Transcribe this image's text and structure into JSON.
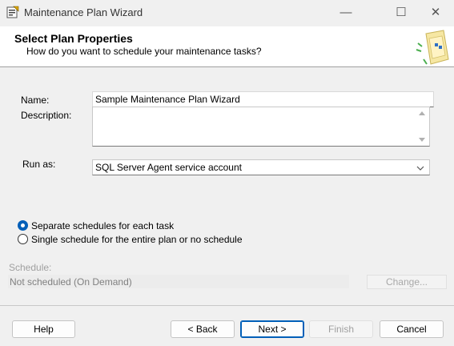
{
  "window": {
    "title": "Maintenance Plan Wizard",
    "icon": "wizard-app-icon",
    "controls": {
      "minimize": "—",
      "maximize": "☐",
      "close": "✕"
    }
  },
  "header": {
    "title": "Select Plan Properties",
    "subtitle": "How do you want to schedule your maintenance tasks?"
  },
  "form": {
    "name_label": "Name:",
    "name_value": "Sample Maintenance Plan Wizard",
    "description_label": "Description:",
    "description_value": "",
    "runas_label": "Run as:",
    "runas_value": "SQL Server Agent service account"
  },
  "schedule_options": {
    "separate": "Separate schedules for each task",
    "single": "Single schedule for the entire plan or no schedule",
    "selected": "separate"
  },
  "schedule": {
    "label": "Schedule:",
    "value": "Not scheduled (On Demand)",
    "change_button": "Change..."
  },
  "buttons": {
    "help": "Help",
    "back": "< Back",
    "next": "Next >",
    "finish": "Finish",
    "cancel": "Cancel"
  },
  "colors": {
    "accent": "#005fb8",
    "disabled_text": "#a0a0a0"
  }
}
